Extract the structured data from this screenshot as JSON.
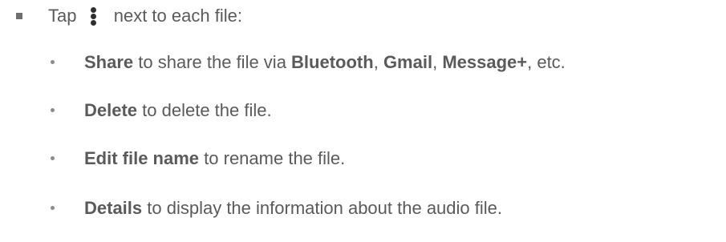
{
  "main": {
    "tap_before": "Tap",
    "tap_after": "next to each file:",
    "menu_icon": "more-vertical-icon",
    "items": [
      {
        "bold": "Share",
        "text1": " to share the file via ",
        "bold2": "Bluetooth",
        "sep1": ", ",
        "bold3": "Gmail",
        "sep2": ", ",
        "bold4": "Message+",
        "tail": ", etc."
      },
      {
        "bold": "Delete",
        "text1": " to delete the file."
      },
      {
        "bold": "Edit file name",
        "text1": " to rename the file."
      },
      {
        "bold": "Details",
        "text1": " to display the information about the audio file."
      }
    ]
  }
}
